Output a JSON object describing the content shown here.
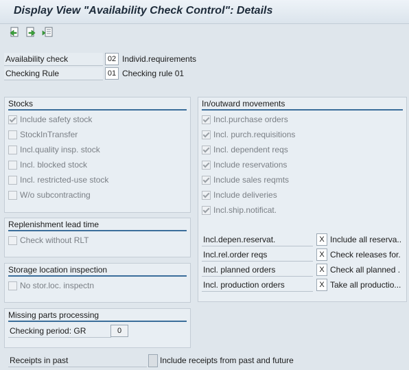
{
  "window": {
    "title": "Display View \"Availability Check Control\": Details"
  },
  "toolbar": {
    "buttons": [
      {
        "icon": "previous-entry-icon"
      },
      {
        "icon": "next-entry-icon"
      },
      {
        "icon": "other-entry-icon"
      }
    ]
  },
  "header": {
    "availability_check": {
      "label": "Availability check",
      "value": "02",
      "desc": "Individ.requirements"
    },
    "checking_rule": {
      "label": "Checking Rule",
      "value": "01",
      "desc": "Checking rule 01"
    }
  },
  "stocks": {
    "title": "Stocks",
    "items": [
      {
        "label": "Include safety stock",
        "checked": true
      },
      {
        "label": "StockInTransfer",
        "checked": false
      },
      {
        "label": "Incl.quality insp. stock",
        "checked": false
      },
      {
        "label": "Incl. blocked stock",
        "checked": false
      },
      {
        "label": "Incl. restricted-use stock",
        "checked": false
      },
      {
        "label": "W/o subcontracting",
        "checked": false
      }
    ]
  },
  "replenishment": {
    "title": "Replenishment lead time",
    "items": [
      {
        "label": "Check without RLT",
        "checked": false
      }
    ]
  },
  "storage": {
    "title": "Storage location inspection",
    "items": [
      {
        "label": "No stor.loc. inspectn",
        "checked": false
      }
    ]
  },
  "missing_parts": {
    "title": "Missing parts processing",
    "checking_period_label": "Checking period: GR",
    "checking_period_value": "0"
  },
  "movements": {
    "title": "In/outward movements",
    "items": [
      {
        "label": "Incl.purchase orders",
        "checked": true
      },
      {
        "label": "Incl. purch.requisitions",
        "checked": true
      },
      {
        "label": "Incl. dependent reqs",
        "checked": true
      },
      {
        "label": "Include reservations",
        "checked": true
      },
      {
        "label": "Include sales reqmts",
        "checked": true
      },
      {
        "label": "Include deliveries",
        "checked": true
      },
      {
        "label": "Incl.ship.notificat.",
        "checked": true
      }
    ],
    "settings": [
      {
        "label": "Incl.depen.reservat.",
        "value": "X",
        "desc": "Include all reserva..."
      },
      {
        "label": "Incl.rel.order reqs",
        "value": "X",
        "desc": "Check releases for..."
      },
      {
        "label": "Incl. planned orders",
        "value": "X",
        "desc": "Check all planned ..."
      },
      {
        "label": "Incl. production orders",
        "value": "X",
        "desc": "Take all productio..."
      }
    ]
  },
  "receipts": {
    "label": "Receipts in past",
    "value": "",
    "desc": "Include receipts from past and future"
  }
}
